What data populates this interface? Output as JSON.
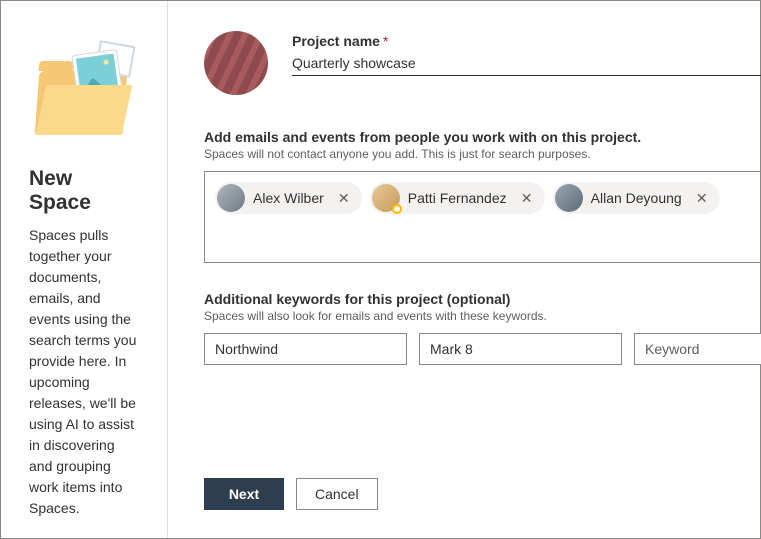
{
  "left": {
    "title": "New Space",
    "description": "Spaces pulls together your documents, emails, and events using the search terms you provide here. In upcoming releases, we'll be using AI to assist in discovering and grouping work items into Spaces."
  },
  "project": {
    "label": "Project name",
    "required_marker": "*",
    "value": "Quarterly showcase"
  },
  "people": {
    "label": "Add emails and events from people you work with on this project.",
    "sub": "Spaces will not contact anyone you add. This is just for search purposes.",
    "chips": [
      {
        "name": "Alex Wilber",
        "presence": false
      },
      {
        "name": "Patti Fernandez",
        "presence": true
      },
      {
        "name": "Allan Deyoung",
        "presence": false
      }
    ]
  },
  "keywords": {
    "label": "Additional keywords for this project (optional)",
    "sub": "Spaces will also look for emails and events with these keywords.",
    "values": [
      "Northwind",
      "Mark 8",
      ""
    ],
    "placeholder": "Keyword"
  },
  "buttons": {
    "primary": "Next",
    "secondary": "Cancel"
  }
}
